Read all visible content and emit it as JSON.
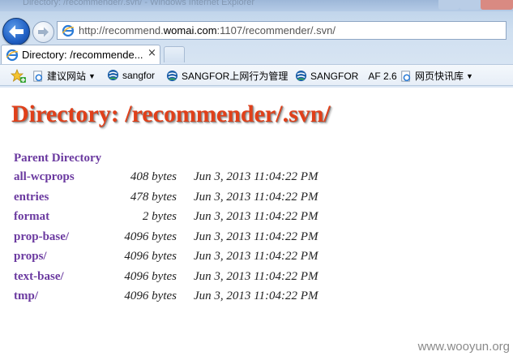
{
  "browser": {
    "window_title": "Directory: /recommender/.svn/ - Windows Internet Explorer",
    "address_bar": {
      "url_prefix": "http://recommend.",
      "url_host": "womai.com",
      "url_suffix": ":1107/recommender/.svn/"
    },
    "tab": {
      "label": "Directory: /recommende...",
      "close_glyph": "×"
    },
    "favorites": [
      {
        "label": "建议网站",
        "icon": "ie-page-icon",
        "has_dropdown": true
      },
      {
        "label": "sangfor",
        "icon": "sangfor-icon",
        "has_dropdown": false
      },
      {
        "label": "SANGFOR上网行为管理",
        "icon": "sangfor-icon",
        "has_dropdown": false
      },
      {
        "label": "SANGFOR　AF 2.6",
        "icon": "sangfor-icon",
        "has_dropdown": false
      },
      {
        "label": "网页快讯库",
        "icon": "ie-page-icon",
        "has_dropdown": true
      }
    ],
    "dropdown_glyph": "▼"
  },
  "page": {
    "title": "Directory: /recommender/.svn/",
    "parent_link": "Parent Directory",
    "entries": [
      {
        "name": "all-wcprops",
        "size": "408 bytes",
        "date": "Jun 3, 2013 11:04:22 PM"
      },
      {
        "name": "entries",
        "size": "478 bytes",
        "date": "Jun 3, 2013 11:04:22 PM"
      },
      {
        "name": "format",
        "size": "2 bytes",
        "date": "Jun 3, 2013 11:04:22 PM"
      },
      {
        "name": "prop-base/",
        "size": "4096 bytes",
        "date": "Jun 3, 2013 11:04:22 PM"
      },
      {
        "name": "props/",
        "size": "4096 bytes",
        "date": "Jun 3, 2013 11:04:22 PM"
      },
      {
        "name": "text-base/",
        "size": "4096 bytes",
        "date": "Jun 3, 2013 11:04:22 PM"
      },
      {
        "name": "tmp/",
        "size": "4096 bytes",
        "date": "Jun 3, 2013 11:04:22 PM"
      }
    ]
  },
  "watermark": "www.wooyun.org",
  "colors": {
    "title": "#e0401a",
    "link": "#6b3aa0",
    "nav_blue": "#1f5fc4"
  }
}
